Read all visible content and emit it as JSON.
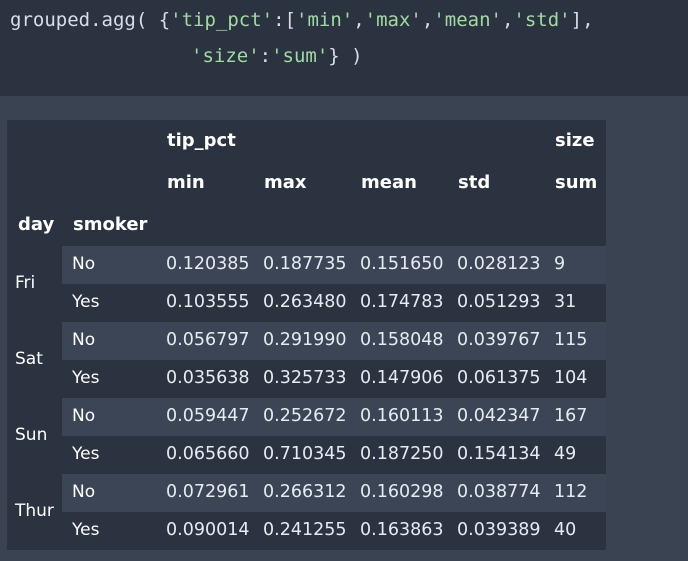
{
  "code": {
    "line1": {
      "fn": "grouped.agg(",
      "open": " {",
      "k1": "'tip_pct'",
      "colon1": ":[",
      "a1": "'min'",
      "c1": ",",
      "a2": "'max'",
      "c2": ",",
      "a3": "'mean'",
      "c3": ",",
      "a4": "'std'",
      "close1": "],"
    },
    "line2": {
      "k2": "'size'",
      "colon2": ":",
      "v2": "'sum'",
      "close2": "} )"
    }
  },
  "table": {
    "top_headers": {
      "tip_pct": "tip_pct",
      "size": "size"
    },
    "sub_headers": {
      "min": "min",
      "max": "max",
      "mean": "mean",
      "std": "std",
      "sum": "sum"
    },
    "index_names": {
      "day": "day",
      "smoker": "smoker"
    },
    "groups": [
      {
        "day": "Fri",
        "rows": [
          {
            "smoker": "No",
            "min": "0.120385",
            "max": "0.187735",
            "mean": "0.151650",
            "std": "0.028123",
            "sum": "9"
          },
          {
            "smoker": "Yes",
            "min": "0.103555",
            "max": "0.263480",
            "mean": "0.174783",
            "std": "0.051293",
            "sum": "31"
          }
        ]
      },
      {
        "day": "Sat",
        "rows": [
          {
            "smoker": "No",
            "min": "0.056797",
            "max": "0.291990",
            "mean": "0.158048",
            "std": "0.039767",
            "sum": "115"
          },
          {
            "smoker": "Yes",
            "min": "0.035638",
            "max": "0.325733",
            "mean": "0.147906",
            "std": "0.061375",
            "sum": "104"
          }
        ]
      },
      {
        "day": "Sun",
        "rows": [
          {
            "smoker": "No",
            "min": "0.059447",
            "max": "0.252672",
            "mean": "0.160113",
            "std": "0.042347",
            "sum": "167"
          },
          {
            "smoker": "Yes",
            "min": "0.065660",
            "max": "0.710345",
            "mean": "0.187250",
            "std": "0.154134",
            "sum": "49"
          }
        ]
      },
      {
        "day": "Thur",
        "rows": [
          {
            "smoker": "No",
            "min": "0.072961",
            "max": "0.266312",
            "mean": "0.160298",
            "std": "0.038774",
            "sum": "112"
          },
          {
            "smoker": "Yes",
            "min": "0.090014",
            "max": "0.241255",
            "mean": "0.163863",
            "std": "0.039389",
            "sum": "40"
          }
        ]
      }
    ]
  },
  "colors": {
    "page_bg": "#3a4352",
    "cell_bg": "#2b3340",
    "row_stripe": "#3b4556",
    "string_token": "#a3d9a5",
    "text": "#ffffff"
  }
}
